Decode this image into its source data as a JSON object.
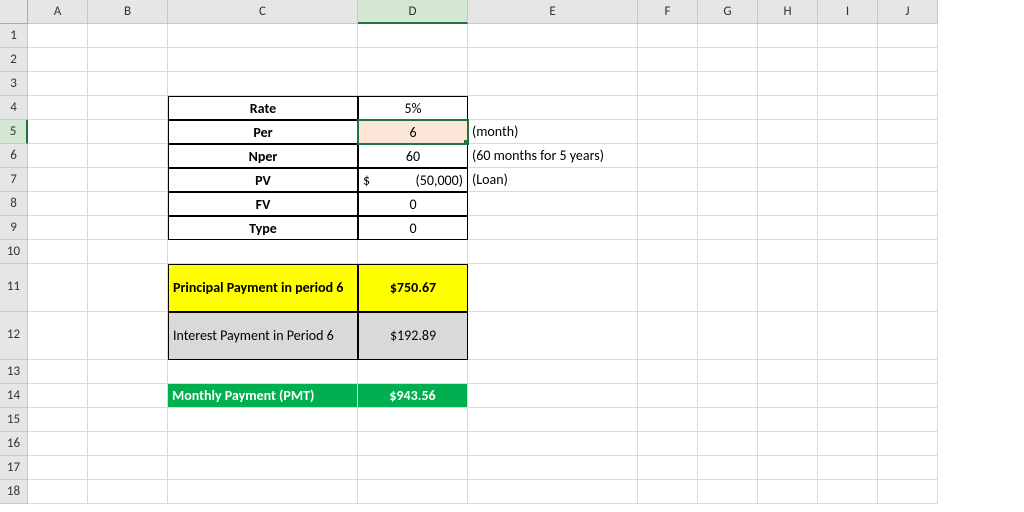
{
  "columns": [
    "A",
    "B",
    "C",
    "D",
    "E",
    "F",
    "G",
    "H",
    "I",
    "J"
  ],
  "rows": [
    "1",
    "2",
    "3",
    "4",
    "5",
    "6",
    "7",
    "8",
    "9",
    "10",
    "11",
    "12",
    "13",
    "14",
    "15",
    "16",
    "17",
    "18"
  ],
  "labels": {
    "rate": "Rate",
    "per": "Per",
    "nper": "Nper",
    "pv": "PV",
    "fv": "FV",
    "type": "Type",
    "principal": "Principal Payment in period 6",
    "interest": "Interest Payment in Period 6",
    "pmt": "Monthly Payment (PMT)"
  },
  "values": {
    "rate": "5%",
    "per": "6",
    "nper": "60",
    "pv_sym": "$",
    "pv_num": "(50,000)",
    "fv": "0",
    "type": "0",
    "principal": "$750.67",
    "interest": "$192.89",
    "pmt": "$943.56"
  },
  "notes": {
    "per": "(month)",
    "nper": "(60 months for 5 years)",
    "pv": "(Loan)"
  },
  "chart_data": {
    "type": "table",
    "title": "Loan PMT inputs and results",
    "rows": [
      {
        "label": "Rate",
        "value": "5%"
      },
      {
        "label": "Per",
        "value": 6,
        "note": "(month)"
      },
      {
        "label": "Nper",
        "value": 60,
        "note": "(60 months for 5 years)"
      },
      {
        "label": "PV",
        "value": -50000,
        "display": "$ (50,000)",
        "note": "(Loan)"
      },
      {
        "label": "FV",
        "value": 0
      },
      {
        "label": "Type",
        "value": 0
      },
      {
        "label": "Principal Payment in period 6",
        "value": 750.67,
        "display": "$750.67"
      },
      {
        "label": "Interest Payment in Period 6",
        "value": 192.89,
        "display": "$192.89"
      },
      {
        "label": "Monthly Payment (PMT)",
        "value": 943.56,
        "display": "$943.56"
      }
    ]
  }
}
